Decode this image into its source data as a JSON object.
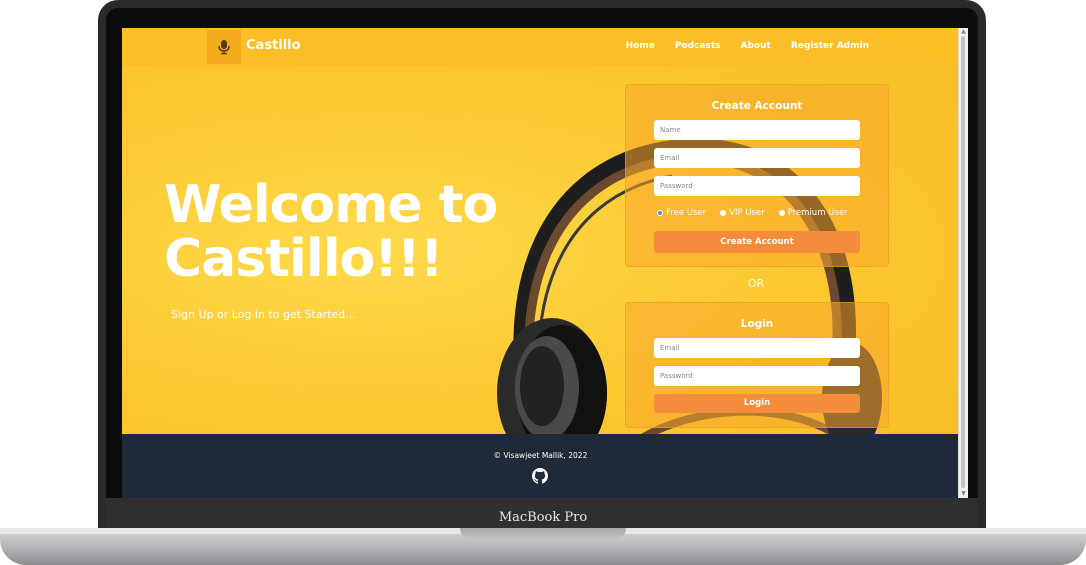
{
  "device": {
    "label": "MacBook Pro"
  },
  "navbar": {
    "brand": "Castillo",
    "links": [
      "Home",
      "Podcasts",
      "About",
      "Register Admin"
    ]
  },
  "hero": {
    "headline_line1": "Welcome to",
    "headline_line2": "Castillo!!!",
    "subtitle": "Sign Up or Log in to get Started..."
  },
  "create_account": {
    "title": "Create Account",
    "name_placeholder": "Name",
    "email_placeholder": "Email",
    "password_placeholder": "Password",
    "user_types": [
      "Free User",
      "VIP User",
      "Premium User"
    ],
    "selected_user_type": "Free User",
    "submit_label": "Create Account"
  },
  "separator": "OR",
  "login": {
    "title": "Login",
    "email_placeholder": "Email",
    "password_placeholder": "Password",
    "submit_label": "Login"
  },
  "footer": {
    "copyright": "© Visawjeet Mallik, 2022",
    "icon": "github-icon"
  },
  "colors": {
    "accent": "#f7c431",
    "button": "#f58c3b",
    "footer": "#1f2937"
  }
}
